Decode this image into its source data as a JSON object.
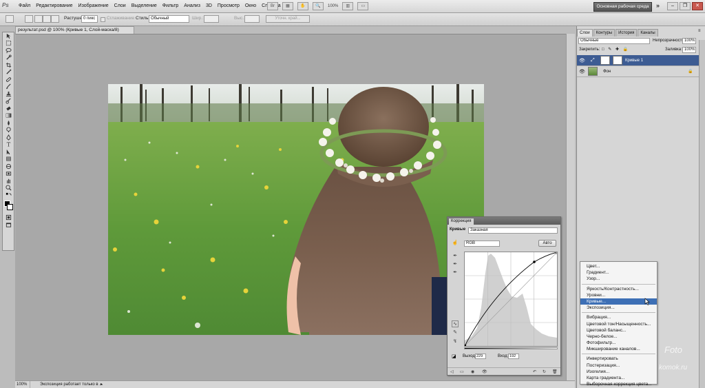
{
  "app": {
    "logo": "Ps"
  },
  "menu": [
    "Файл",
    "Редактирование",
    "Изображение",
    "Слои",
    "Выделение",
    "Фильтр",
    "Анализ",
    "3D",
    "Просмотр",
    "Окно",
    "Справка"
  ],
  "menubar_tools": {
    "zoom": "100%"
  },
  "workspace": {
    "label": "Основная рабочая среда",
    "more": "»"
  },
  "options": {
    "feather_label": "Растушевка:",
    "feather_value": "0 пикс",
    "antialias_label": "Сглаживание",
    "style_label": "Стиль:",
    "style_value": "Обычный",
    "width_label": "Шир.:",
    "height_label": "Выс.:",
    "refine_label": "Уточн. край..."
  },
  "document": {
    "tab": "результат.psd @ 100% (Кривые 1, Слой-маска/8)"
  },
  "status": {
    "zoom": "100%",
    "text": "Экспозиция работает только в ..."
  },
  "layers_panel": {
    "tabs": [
      "Слои",
      "Контуры",
      "История",
      "Каналы"
    ],
    "blend_mode": "Обычные",
    "opacity_label": "Непрозрачность:",
    "opacity_value": "100%",
    "lock_label": "Закрепить:",
    "fill_label": "Заливка:",
    "fill_value": "100%",
    "layers": [
      {
        "name": "Кривые 1",
        "selected": true
      },
      {
        "name": "Фон",
        "selected": false
      }
    ]
  },
  "adjustments": {
    "tab": "Коррекция",
    "type_label": "Кривые",
    "preset": "Заказная",
    "channel": "RGB",
    "auto": "Авто",
    "output_label": "Выход:",
    "output_value": "229",
    "input_label": "Вход:",
    "input_value": "192"
  },
  "adjustment_menu": {
    "groups": [
      [
        "Цвет...",
        "Градиент...",
        "Узор..."
      ],
      [
        "Яркость/Контрастность...",
        "Уровни...",
        "Кривые...",
        "Экспозиция..."
      ],
      [
        "Вибрация...",
        "Цветовой тон/Насыщенность...",
        "Цветовой баланс...",
        "Черно-белое...",
        "Фотофильтр...",
        "Микширование каналов..."
      ],
      [
        "Инвертировать",
        "Постеризация...",
        "Изогелия...",
        "Карта градиента...",
        "Выборочная коррекция цвета..."
      ]
    ],
    "highlighted": "Кривые..."
  },
  "watermark": [
    "Foto",
    "komok.ru"
  ],
  "colors": {
    "selection": "#3d5c93",
    "menu_highlight": "#3d6fb5",
    "workspace_button": "#555555"
  }
}
